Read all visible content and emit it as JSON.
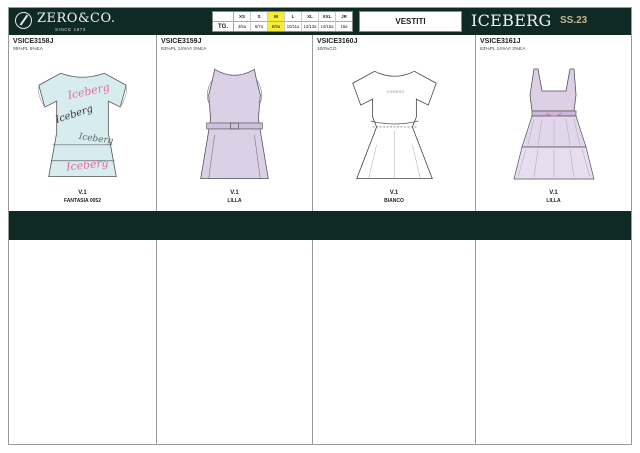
{
  "header": {
    "brand": "ZERO&CO.",
    "brand_since": "SINCE 1973",
    "category": "VESTITI",
    "label_brand": "ICEBERG",
    "season": "SS.23"
  },
  "size_table": {
    "label": "TG.",
    "columns": [
      {
        "size": "XS",
        "age": "4/5a"
      },
      {
        "size": "S",
        "age": "6/7a"
      },
      {
        "size": "M",
        "age": "8/9a",
        "highlight": true
      },
      {
        "size": "L",
        "age": "10/11a"
      },
      {
        "size": "XL",
        "age": "12/13a"
      },
      {
        "size": "XXL",
        "age": "14/15a"
      },
      {
        "size": "JR",
        "age": "16a"
      }
    ],
    "highlight_color": "#f6ec3a"
  },
  "products": [
    {
      "code": "VSICE3158J",
      "composition": "95%PL 5%EA",
      "version": "V.1",
      "color": "FANTASIA 0052",
      "fill": "#d6ecef"
    },
    {
      "code": "VSICE3159J",
      "composition": "83%PL 14%VI 3%EA",
      "version": "V.1",
      "color": "LILLA",
      "fill": "#dcd0e6"
    },
    {
      "code": "VSICE3160J",
      "composition": "100%CO",
      "version": "V.1",
      "color": "BIANCO",
      "fill": "#ffffff"
    },
    {
      "code": "VSICE3161J",
      "composition": "83%PL 14%VI 3%EA",
      "version": "V.1",
      "color": "LILLA",
      "fill": "#dccfe6"
    }
  ],
  "colors": {
    "header_bg": "#0f2a24",
    "season_gold": "#c9b48a"
  }
}
